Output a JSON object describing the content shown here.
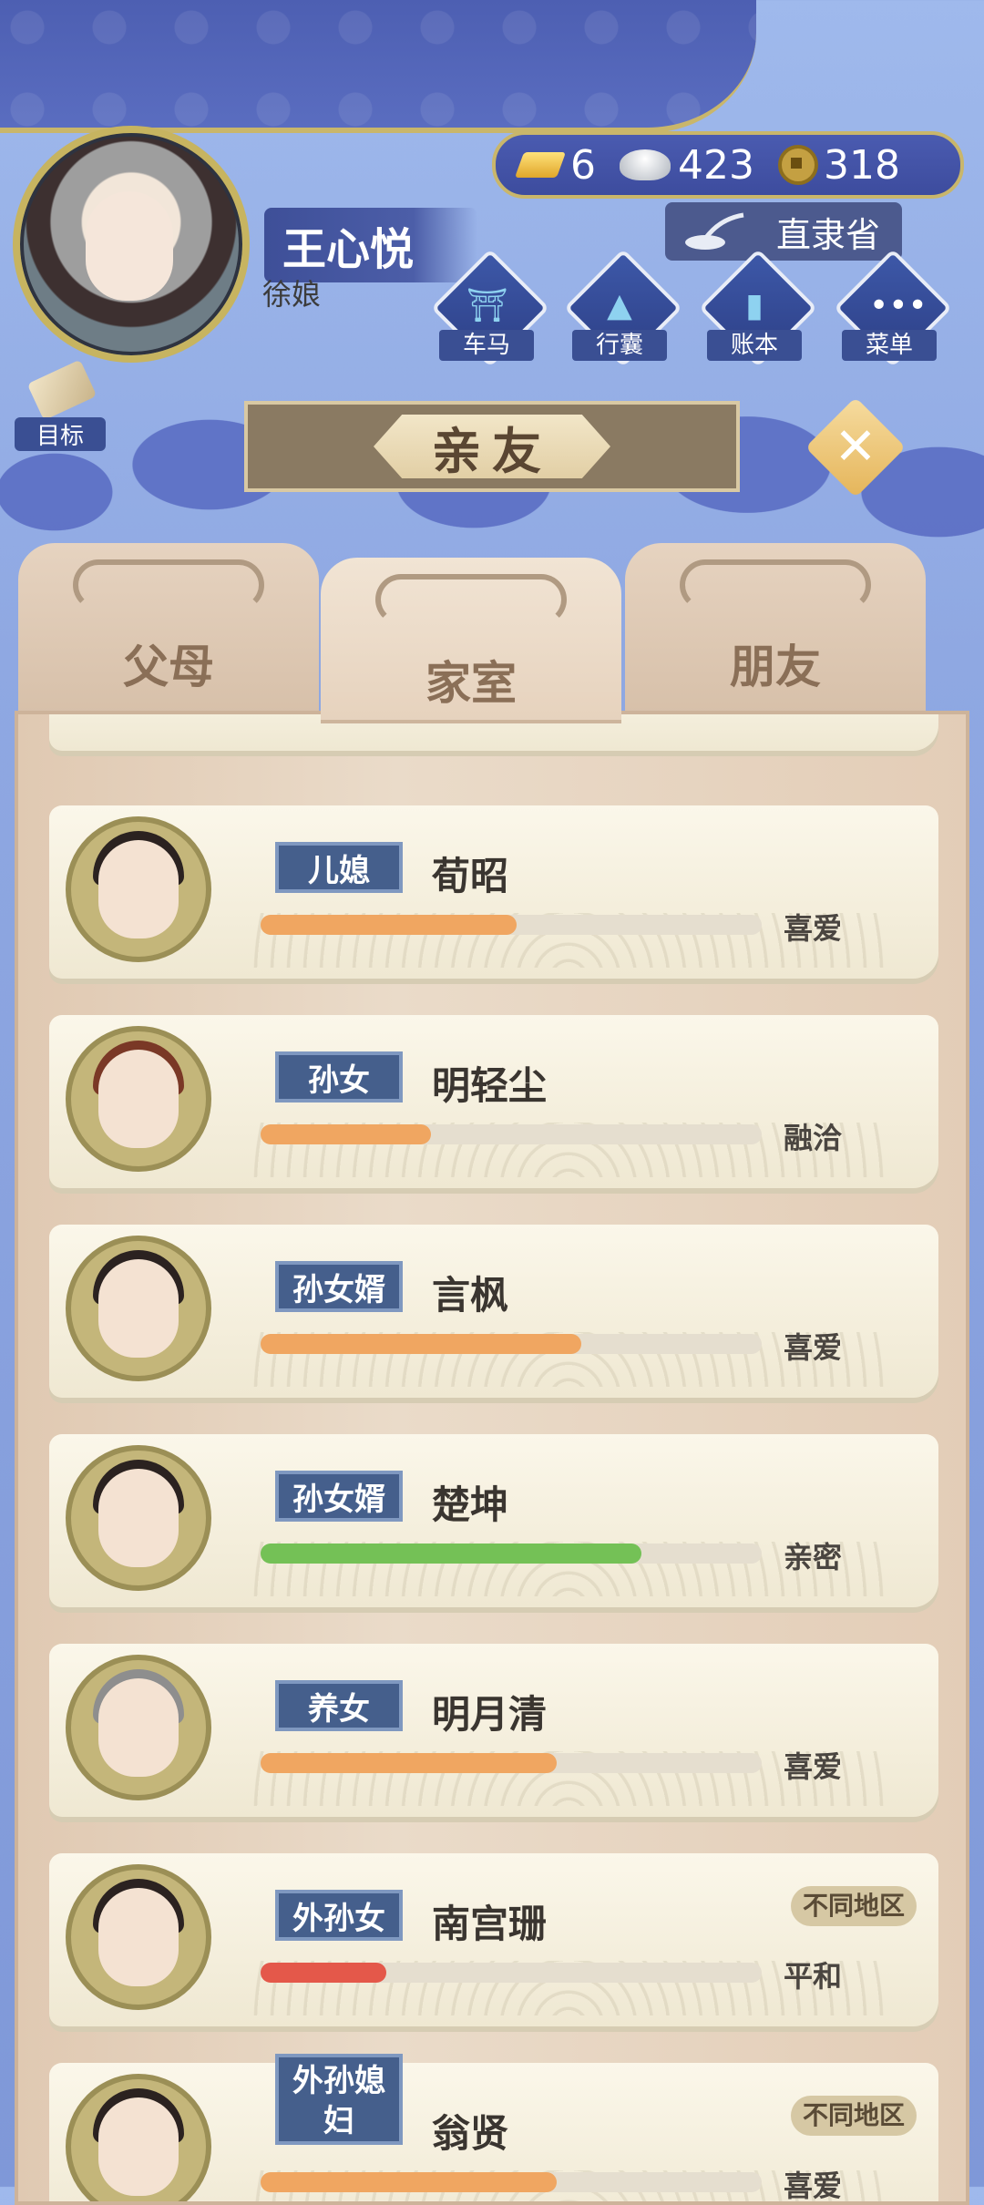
{
  "player": {
    "name": "王心悦",
    "title": "徐娘"
  },
  "currency": {
    "gold": "6",
    "silver": "423",
    "coins": "318"
  },
  "location": "直隶省",
  "quick_menu": [
    {
      "label": "车马",
      "icon": "carriage-icon"
    },
    {
      "label": "行囊",
      "icon": "bundle-icon"
    },
    {
      "label": "账本",
      "icon": "ledger-icon"
    },
    {
      "label": "菜单",
      "icon": "more-icon"
    }
  ],
  "goal_label": "目标",
  "panel_title": "亲友",
  "tabs": [
    {
      "label": "父母",
      "active": false
    },
    {
      "label": "家室",
      "active": true
    },
    {
      "label": "朋友",
      "active": false
    }
  ],
  "relatives": [
    {
      "role": "儿媳",
      "name": "荀昭",
      "relation": "喜爱",
      "affinity": 0.51,
      "bar_color": "#f0a661",
      "region": ""
    },
    {
      "role": "孙女",
      "name": "明轻尘",
      "relation": "融洽",
      "affinity": 0.34,
      "bar_color": "#f0a661",
      "region": ""
    },
    {
      "role": "孙女婿",
      "name": "言枫",
      "relation": "喜爱",
      "affinity": 0.64,
      "bar_color": "#f0a661",
      "region": ""
    },
    {
      "role": "孙女婿",
      "name": "楚坤",
      "relation": "亲密",
      "affinity": 0.76,
      "bar_color": "#74c156",
      "region": ""
    },
    {
      "role": "养女",
      "name": "明月清",
      "relation": "喜爱",
      "affinity": 0.59,
      "bar_color": "#f0a661",
      "region": ""
    },
    {
      "role": "外孙女",
      "name": "南宫珊",
      "relation": "平和",
      "affinity": 0.25,
      "bar_color": "#e4584a",
      "region": "不同地区"
    },
    {
      "role": "外孙媳妇",
      "name": "翁贤",
      "relation": "喜爱",
      "affinity": 0.59,
      "bar_color": "#f0a661",
      "region": "不同地区"
    }
  ]
}
